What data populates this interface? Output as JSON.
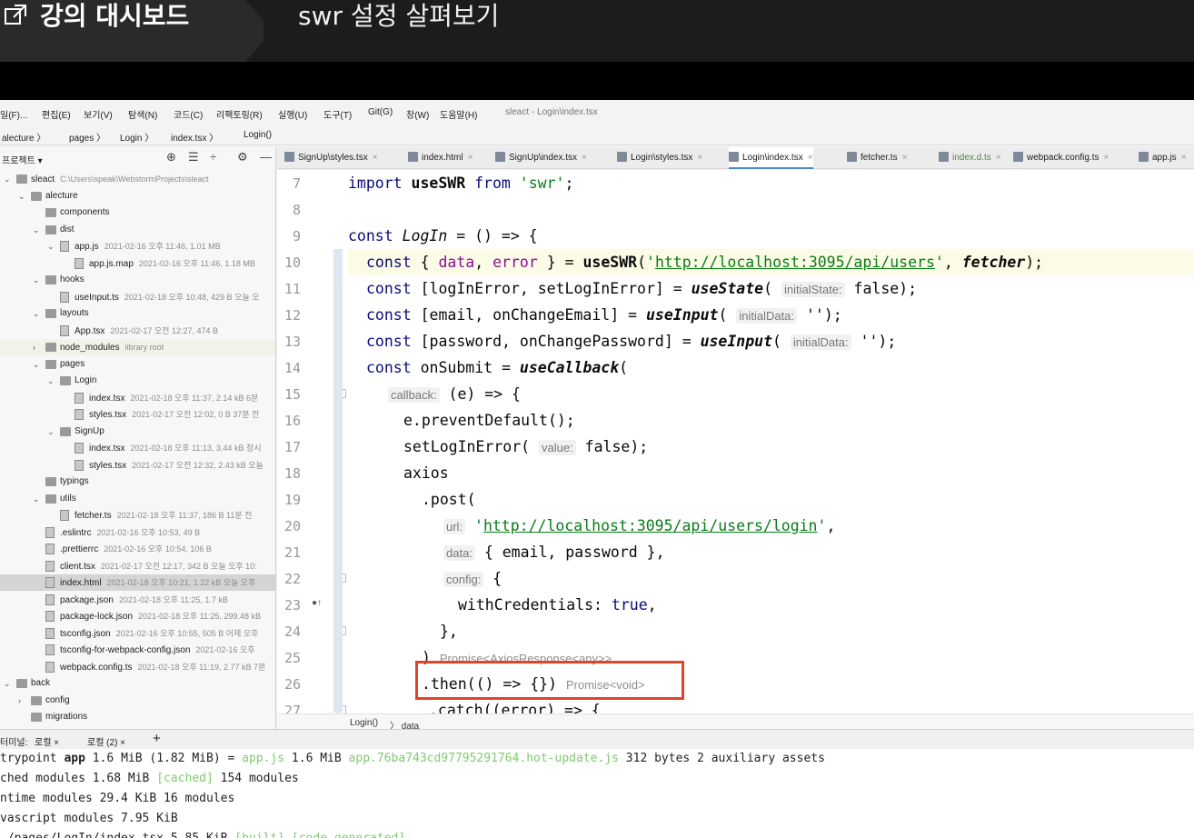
{
  "lecture": {
    "dashboard_label": "강의 대시보드",
    "lesson_title": "swr 설정 살펴보기"
  },
  "ide": {
    "menu": [
      "일(F)...",
      "편집(E)",
      "보기(V)",
      "탐색(N)",
      "코드(C)",
      "리팩토링(R)",
      "실행(U)",
      "도구(T)",
      "Git(G)",
      "창(W)",
      "도움말(H)"
    ],
    "window_title": "sleact - Login\\index.tsx",
    "path": [
      "alecture",
      "pages",
      "Login",
      "index.tsx",
      "Login()"
    ],
    "project_label": "프로젝트",
    "tree": [
      {
        "name": "sleact",
        "meta": "C:\\Users\\speak\\WebstormProjects\\sleact",
        "depth": 0,
        "type": "folder",
        "open": true
      },
      {
        "name": "alecture",
        "meta": "",
        "depth": 1,
        "type": "folder",
        "open": true
      },
      {
        "name": "components",
        "meta": "",
        "depth": 2,
        "type": "folder",
        "open": false,
        "noarrow": true
      },
      {
        "name": "dist",
        "meta": "",
        "depth": 2,
        "type": "folder",
        "open": true
      },
      {
        "name": "app.js",
        "meta": "2021-02-16 오후 11:46, 1.01 MB",
        "depth": 3,
        "type": "file",
        "open": true
      },
      {
        "name": "app.js.map",
        "meta": "2021-02-16 오후 11:46, 1.18 MB",
        "depth": 4,
        "type": "file"
      },
      {
        "name": "hooks",
        "meta": "",
        "depth": 2,
        "type": "folder",
        "open": true
      },
      {
        "name": "useInput.ts",
        "meta": "2021-02-18 오후 10:48, 429 B 오늘 오",
        "depth": 3,
        "type": "file"
      },
      {
        "name": "layouts",
        "meta": "",
        "depth": 2,
        "type": "folder",
        "open": true
      },
      {
        "name": "App.tsx",
        "meta": "2021-02-17 오전 12:27, 474 B",
        "depth": 3,
        "type": "file"
      },
      {
        "name": "node_modules",
        "meta": "library root",
        "depth": 2,
        "type": "folder",
        "open": false,
        "lib": true
      },
      {
        "name": "pages",
        "meta": "",
        "depth": 2,
        "type": "folder",
        "open": true
      },
      {
        "name": "Login",
        "meta": "",
        "depth": 3,
        "type": "folder",
        "open": true
      },
      {
        "name": "index.tsx",
        "meta": "2021-02-18 오후 11:37, 2.14 kB 6분",
        "depth": 4,
        "type": "file"
      },
      {
        "name": "styles.tsx",
        "meta": "2021-02-17 오전 12:02, 0 B 37분 전",
        "depth": 4,
        "type": "file"
      },
      {
        "name": "SignUp",
        "meta": "",
        "depth": 3,
        "type": "folder",
        "open": true
      },
      {
        "name": "index.tsx",
        "meta": "2021-02-18 오후 11:13, 3.44 kB 장시",
        "depth": 4,
        "type": "file"
      },
      {
        "name": "styles.tsx",
        "meta": "2021-02-17 오전 12:32, 2.43 kB 오늘",
        "depth": 4,
        "type": "file"
      },
      {
        "name": "typings",
        "meta": "",
        "depth": 2,
        "type": "folder",
        "open": false,
        "noarrow": true
      },
      {
        "name": "utils",
        "meta": "",
        "depth": 2,
        "type": "folder",
        "open": true
      },
      {
        "name": "fetcher.ts",
        "meta": "2021-02-18 오후 11:37, 186 B 11분 전",
        "depth": 3,
        "type": "file"
      },
      {
        "name": ".eslintrc",
        "meta": "2021-02-16 오후 10:53, 49 B",
        "depth": 2,
        "type": "file",
        "noarrow": true
      },
      {
        "name": ".prettierrc",
        "meta": "2021-02-16 오후 10:54, 106 B",
        "depth": 2,
        "type": "file",
        "noarrow": true
      },
      {
        "name": "client.tsx",
        "meta": "2021-02-17 오전 12:17, 342 B 오늘 오후 10:",
        "depth": 2,
        "type": "file",
        "noarrow": true
      },
      {
        "name": "index.html",
        "meta": "2021-02-18 오후 10:21, 1.22 kB 오늘 오후",
        "depth": 2,
        "type": "file",
        "noarrow": true,
        "sel": true
      },
      {
        "name": "package.json",
        "meta": "2021-02-18 오후 11:25, 1.7 kB",
        "depth": 2,
        "type": "file",
        "noarrow": true
      },
      {
        "name": "package-lock.json",
        "meta": "2021-02-18 오후 11:25, 299.48 kB",
        "depth": 2,
        "type": "file",
        "noarrow": true
      },
      {
        "name": "tsconfig.json",
        "meta": "2021-02-16 오후 10:55, 505 B 어제 오후",
        "depth": 2,
        "type": "file",
        "noarrow": true
      },
      {
        "name": "tsconfig-for-webpack-config.json",
        "meta": "2021-02-16 오후",
        "depth": 2,
        "type": "file",
        "noarrow": true
      },
      {
        "name": "webpack.config.ts",
        "meta": "2021-02-18 오후 11:19, 2.77 kB 7분",
        "depth": 2,
        "type": "file",
        "noarrow": true
      },
      {
        "name": "back",
        "meta": "",
        "depth": 0,
        "type": "folder",
        "open": true
      },
      {
        "name": "config",
        "meta": "",
        "depth": 1,
        "type": "folder",
        "open": false
      },
      {
        "name": "migrations",
        "meta": "",
        "depth": 1,
        "type": "folder",
        "open": false,
        "noarrow": true
      }
    ],
    "tabs": [
      {
        "label": "SignUp\\styles.tsx"
      },
      {
        "label": "index.html"
      },
      {
        "label": "SignUp\\index.tsx"
      },
      {
        "label": "Login\\styles.tsx"
      },
      {
        "label": "Login\\index.tsx",
        "active": true
      },
      {
        "label": "fetcher.ts"
      },
      {
        "label": "index.d.ts",
        "green": true
      },
      {
        "label": "webpack.config.ts"
      },
      {
        "label": "app.js"
      }
    ],
    "line_numbers": [
      "7",
      "8",
      "9",
      "10",
      "11",
      "12",
      "13",
      "14",
      "15",
      "16",
      "17",
      "18",
      "19",
      "20",
      "21",
      "22",
      "23",
      "24",
      "25",
      "26",
      "27"
    ],
    "code_breadcrumb": [
      "Login()",
      "data"
    ],
    "terminal_tabs": [
      "터미널:",
      "로컬",
      "로컬 (2)",
      "+"
    ],
    "terminal": [
      {
        "a": "trypoint ",
        "b": "app",
        "c": " 1.6 MiB (1.82 MiB) = ",
        "g1": "app.js",
        "d": " 1.6 MiB ",
        "g2": "app.76ba743cd97795291764.hot-update.js",
        "e": " 312 bytes 2 auxiliary assets"
      },
      {
        "a": "ched modules 1.68 MiB ",
        "g1": "[cached]",
        "e": " 154 modules"
      },
      {
        "a": "ntime modules 29.4 KiB 16 modules"
      },
      {
        "a": "vascript modules 7.95 KiB"
      },
      {
        "a": "./pages/LogIn/index.tsx 5.85 KiB ",
        "g1": "[built] [code generated]"
      }
    ]
  },
  "code": {
    "l7": {
      "k1": "import ",
      "f": "useSWR",
      "k2": " from ",
      "s": "'swr'",
      "e": ";"
    },
    "l9": {
      "k": "const ",
      "n": "LogIn",
      "e": " = () => {"
    },
    "l10": {
      "k": "const ",
      "p1": "{ ",
      "v1": "data",
      "p2": ", ",
      "v2": "error",
      "p3": " } = ",
      "f": "useSWR",
      "p4": "(",
      "s1": "'",
      "u": "http://localhost:3095/api/users",
      "s2": "'",
      "p5": ", ",
      "f2": "fetcher",
      "e": ");"
    },
    "l11": {
      "k": "const ",
      "p": "[logInError, setLogInError] = ",
      "f": "useState",
      "p2": "( ",
      "h": "initialState:",
      "e": " false);"
    },
    "l12": {
      "k": "const ",
      "p": "[email, onChangeEmail] = ",
      "f": "useInput",
      "p2": "( ",
      "h": "initialData:",
      "e": " '');"
    },
    "l13": {
      "k": "const ",
      "p": "[password, onChangePassword] = ",
      "f": "useInput",
      "p2": "( ",
      "h": "initialData:",
      "e": " '');"
    },
    "l14": {
      "k": "const ",
      "p": "onSubmit = ",
      "f": "useCallback",
      "e": "("
    },
    "l15": {
      "h": "callback:",
      "e": " (e) => {"
    },
    "l16": {
      "e": "e.preventDefault();"
    },
    "l17": {
      "p": "setLogInError( ",
      "h": "value:",
      "e": " false);"
    },
    "l18": {
      "e": "axios"
    },
    "l19": {
      "e": ".post("
    },
    "l20": {
      "h": "url:",
      "s1": " '",
      "u": "http://localhost:3095/api/users/login",
      "s2": "'",
      "e": ","
    },
    "l21": {
      "h": "data:",
      "e": " { email, password },"
    },
    "l22": {
      "h": "config:",
      "e": " {"
    },
    "l23": {
      "e": "withCredentials: ",
      "k": "true",
      "e2": ","
    },
    "l24": {
      "e": "},"
    },
    "l25": {
      "e": ") ",
      "g": "Promise<AxiosResponse<any>>"
    },
    "l26": {
      "e": ".then(() => {}) ",
      "g": "Promise<void>"
    },
    "l27": {
      "e": ".catch((error) => {"
    }
  }
}
